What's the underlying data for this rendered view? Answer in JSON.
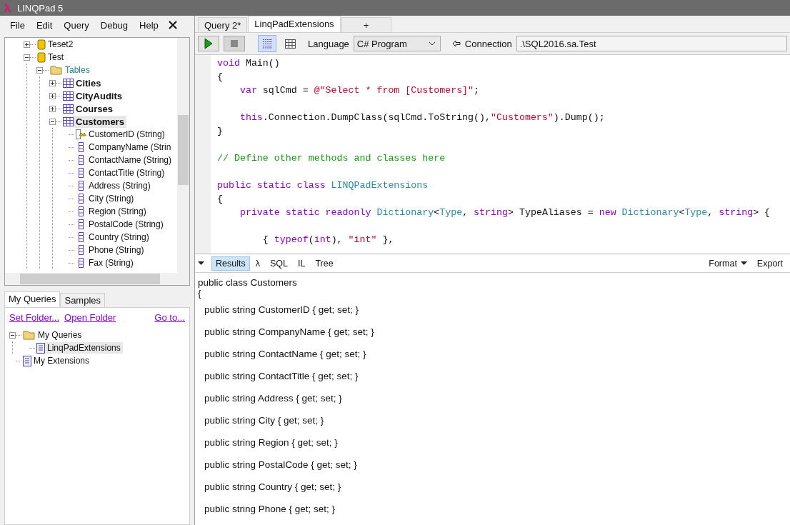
{
  "window": {
    "title": "LINQPad 5"
  },
  "menu": [
    "File",
    "Edit",
    "Query",
    "Debug",
    "Help"
  ],
  "schema_tree": [
    {
      "label": "Teset2",
      "kind": "database",
      "expanded": false,
      "selected": false
    },
    {
      "label": "Test",
      "kind": "database",
      "expanded": true,
      "selected": false,
      "children": [
        {
          "label": "Tables",
          "kind": "folder",
          "expanded": true,
          "selected": false,
          "children": [
            {
              "label": "Cities",
              "kind": "table",
              "expanded": false,
              "selected": false
            },
            {
              "label": "CityAudits",
              "kind": "table",
              "expanded": false,
              "selected": false
            },
            {
              "label": "Courses",
              "kind": "table",
              "expanded": false,
              "selected": false
            },
            {
              "label": "Customers",
              "kind": "table",
              "expanded": true,
              "selected": true,
              "children": [
                {
                  "label": "CustomerID (String)",
                  "kind": "key",
                  "selected": false
                },
                {
                  "label": "CompanyName (Strin",
                  "kind": "column",
                  "selected": false
                },
                {
                  "label": "ContactName (String)",
                  "kind": "column",
                  "selected": false
                },
                {
                  "label": "ContactTitle (String)",
                  "kind": "column",
                  "selected": false
                },
                {
                  "label": "Address (String)",
                  "kind": "column",
                  "selected": false
                },
                {
                  "label": "City (String)",
                  "kind": "column",
                  "selected": false
                },
                {
                  "label": "Region (String)",
                  "kind": "column",
                  "selected": false
                },
                {
                  "label": "PostalCode (String)",
                  "kind": "column",
                  "selected": false
                },
                {
                  "label": "Country (String)",
                  "kind": "column",
                  "selected": false
                },
                {
                  "label": "Phone (String)",
                  "kind": "column",
                  "selected": false
                },
                {
                  "label": "Fax (String)",
                  "kind": "column",
                  "selected": false
                }
              ]
            }
          ]
        }
      ]
    }
  ],
  "explorer": {
    "tabs": [
      {
        "label": "My Queries",
        "selected": true
      },
      {
        "label": "Samples",
        "selected": false
      }
    ],
    "links": [
      "Set Folder...",
      "Open Folder",
      "Go to..."
    ],
    "tree": [
      {
        "label": "My Queries",
        "kind": "folder",
        "expanded": true,
        "selected": false,
        "children": [
          {
            "label": "LinqPadExtensions",
            "kind": "query",
            "selected": true
          }
        ]
      },
      {
        "label": "My Extensions",
        "kind": "query",
        "selected": false
      }
    ]
  },
  "query_tabs": [
    {
      "label": "Query 2*",
      "selected": false
    },
    {
      "label": "LinqPadExtensions",
      "selected": true
    },
    {
      "label": "+",
      "selected": false
    }
  ],
  "toolbar": {
    "view_modes": [
      {
        "kind": "text",
        "selected": true
      },
      {
        "kind": "grid",
        "selected": false
      }
    ],
    "language_label": "Language",
    "language": "C# Program",
    "connection_label": "Connection",
    "connection": ".\\SQL2016.sa.Test"
  },
  "editor": {
    "lines": [
      {
        "gap_before": false,
        "tokens": [
          {
            "text": "void",
            "kind": "keyword"
          },
          {
            "text": " Main()",
            "kind": "plain"
          }
        ]
      },
      {
        "gap_before": false,
        "tokens": [
          {
            "text": "{",
            "kind": "plain"
          }
        ]
      },
      {
        "gap_before": false,
        "tokens": [
          {
            "text": "    var",
            "kind": "keyword"
          },
          {
            "text": " sqlCmd = ",
            "kind": "plain"
          },
          {
            "text": "@\"Select * from [Customers]\"",
            "kind": "string"
          },
          {
            "text": ";",
            "kind": "plain"
          }
        ]
      },
      {
        "gap_before": true,
        "tokens": [
          {
            "text": "    this",
            "kind": "keyword"
          },
          {
            "text": ".Connection.DumpClass(sqlCmd.ToString(),",
            "kind": "plain"
          },
          {
            "text": "\"Customers\"",
            "kind": "string"
          },
          {
            "text": ").Dump();",
            "kind": "plain"
          }
        ]
      },
      {
        "gap_before": false,
        "tokens": [
          {
            "text": "}",
            "kind": "plain"
          }
        ]
      },
      {
        "gap_before": true,
        "tokens": [
          {
            "text": "// Define other methods and classes here",
            "kind": "comment"
          }
        ]
      },
      {
        "gap_before": true,
        "tokens": [
          {
            "text": "public static class ",
            "kind": "keyword"
          },
          {
            "text": "LINQPadExtensions",
            "kind": "type"
          }
        ]
      },
      {
        "gap_before": false,
        "tokens": [
          {
            "text": "{",
            "kind": "plain"
          }
        ]
      },
      {
        "gap_before": false,
        "tokens": [
          {
            "text": "    private static readonly ",
            "kind": "keyword"
          },
          {
            "text": "Dictionary",
            "kind": "type"
          },
          {
            "text": "<",
            "kind": "plain"
          },
          {
            "text": "Type",
            "kind": "type"
          },
          {
            "text": ", ",
            "kind": "plain"
          },
          {
            "text": "string",
            "kind": "keyword"
          },
          {
            "text": "> TypeAliases = ",
            "kind": "plain"
          },
          {
            "text": "new ",
            "kind": "keyword"
          },
          {
            "text": "Dictionary",
            "kind": "type"
          },
          {
            "text": "<",
            "kind": "plain"
          },
          {
            "text": "Type",
            "kind": "type"
          },
          {
            "text": ", ",
            "kind": "plain"
          },
          {
            "text": "string",
            "kind": "keyword"
          },
          {
            "text": "> {",
            "kind": "plain"
          }
        ]
      },
      {
        "gap_before": true,
        "tokens": [
          {
            "text": "        { ",
            "kind": "plain"
          },
          {
            "text": "typeof",
            "kind": "keyword"
          },
          {
            "text": "(",
            "kind": "plain"
          },
          {
            "text": "int",
            "kind": "keyword"
          },
          {
            "text": "), ",
            "kind": "plain"
          },
          {
            "text": "\"int\"",
            "kind": "string"
          },
          {
            "text": " },",
            "kind": "plain"
          }
        ]
      }
    ]
  },
  "results_tabs": [
    {
      "label": "Results",
      "selected": true
    },
    {
      "label": "λ",
      "selected": false
    },
    {
      "label": "SQL",
      "selected": false
    },
    {
      "label": "IL",
      "selected": false
    },
    {
      "label": "Tree",
      "selected": false
    }
  ],
  "results_menu": [
    "Format",
    "Export"
  ],
  "results": {
    "header": "public class Customers",
    "open": "{",
    "properties": [
      "public string CustomerID { get; set; }",
      "public string CompanyName { get; set; }",
      "public string ContactName { get; set; }",
      "public string ContactTitle { get; set; }",
      "public string Address { get; set; }",
      "public string City { get; set; }",
      "public string Region { get; set; }",
      "public string PostalCode { get; set; }",
      "public string Country { get; set; }",
      "public string Phone { get; set; }"
    ]
  }
}
